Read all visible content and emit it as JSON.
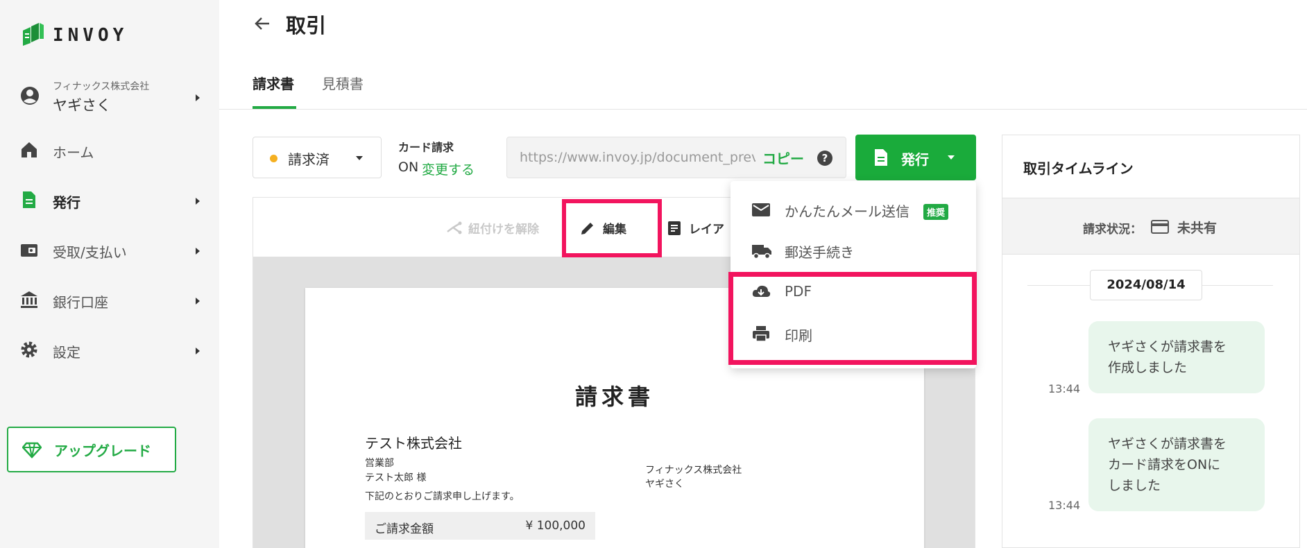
{
  "brand": {
    "name": "INVOY",
    "accent": "#22aa44",
    "highlight": "#f2145e"
  },
  "account": {
    "company": "フィナックス株式会社",
    "user": "ヤギさく"
  },
  "sidebar": {
    "items": [
      {
        "label": "ホーム",
        "icon": "home-icon"
      },
      {
        "label": "発行",
        "icon": "document-icon"
      },
      {
        "label": "受取/支払い",
        "icon": "wallet-icon"
      },
      {
        "label": "銀行口座",
        "icon": "bank-icon"
      },
      {
        "label": "設定",
        "icon": "gear-icon"
      }
    ],
    "upgrade_label": "アップグレード"
  },
  "header": {
    "title": "取引",
    "tabs": [
      {
        "label": "請求書"
      },
      {
        "label": "見積書"
      }
    ]
  },
  "toolbar": {
    "status": "請求済",
    "card_billing_title": "カード請求",
    "card_billing_state": "ON",
    "card_billing_change": "変更する",
    "url": "https://www.invoy.jp/document_preview",
    "copy_label": "コピー",
    "issue_label": "発行"
  },
  "doc_toolbar": {
    "unlink_label": "紐付けを解除",
    "edit_label": "編集",
    "layout_label": "レイア"
  },
  "dropdown": {
    "items": [
      {
        "label": "かんたんメール送信",
        "badge": "推奨",
        "icon": "mail-icon"
      },
      {
        "label": "郵送手続き",
        "icon": "truck-icon"
      },
      {
        "label": "PDF",
        "icon": "cloud-download-icon"
      },
      {
        "label": "印刷",
        "icon": "printer-icon"
      }
    ]
  },
  "invoice": {
    "title": "請求書",
    "recipient": "テスト株式会社",
    "department": "営業部",
    "contact": "テスト太郎 様",
    "note": "下記のとおりご請求申し上げます。",
    "sender_company": "フィナックス株式会社",
    "sender_name": "ヤギさく",
    "amount_label": "ご請求金額",
    "amount_value": "¥ 100,000"
  },
  "timeline": {
    "title": "取引タイムライン",
    "status_label": "請求状況：",
    "status_value": "未共有",
    "date": "2024/08/14",
    "events": [
      {
        "line1": "ヤギさくが請求書を",
        "line2": "作成しました",
        "line3": "",
        "time": "13:44"
      },
      {
        "line1": "ヤギさくが請求書を",
        "line2": "カード請求をONに",
        "line3": "しました",
        "time": "13:44"
      }
    ]
  }
}
